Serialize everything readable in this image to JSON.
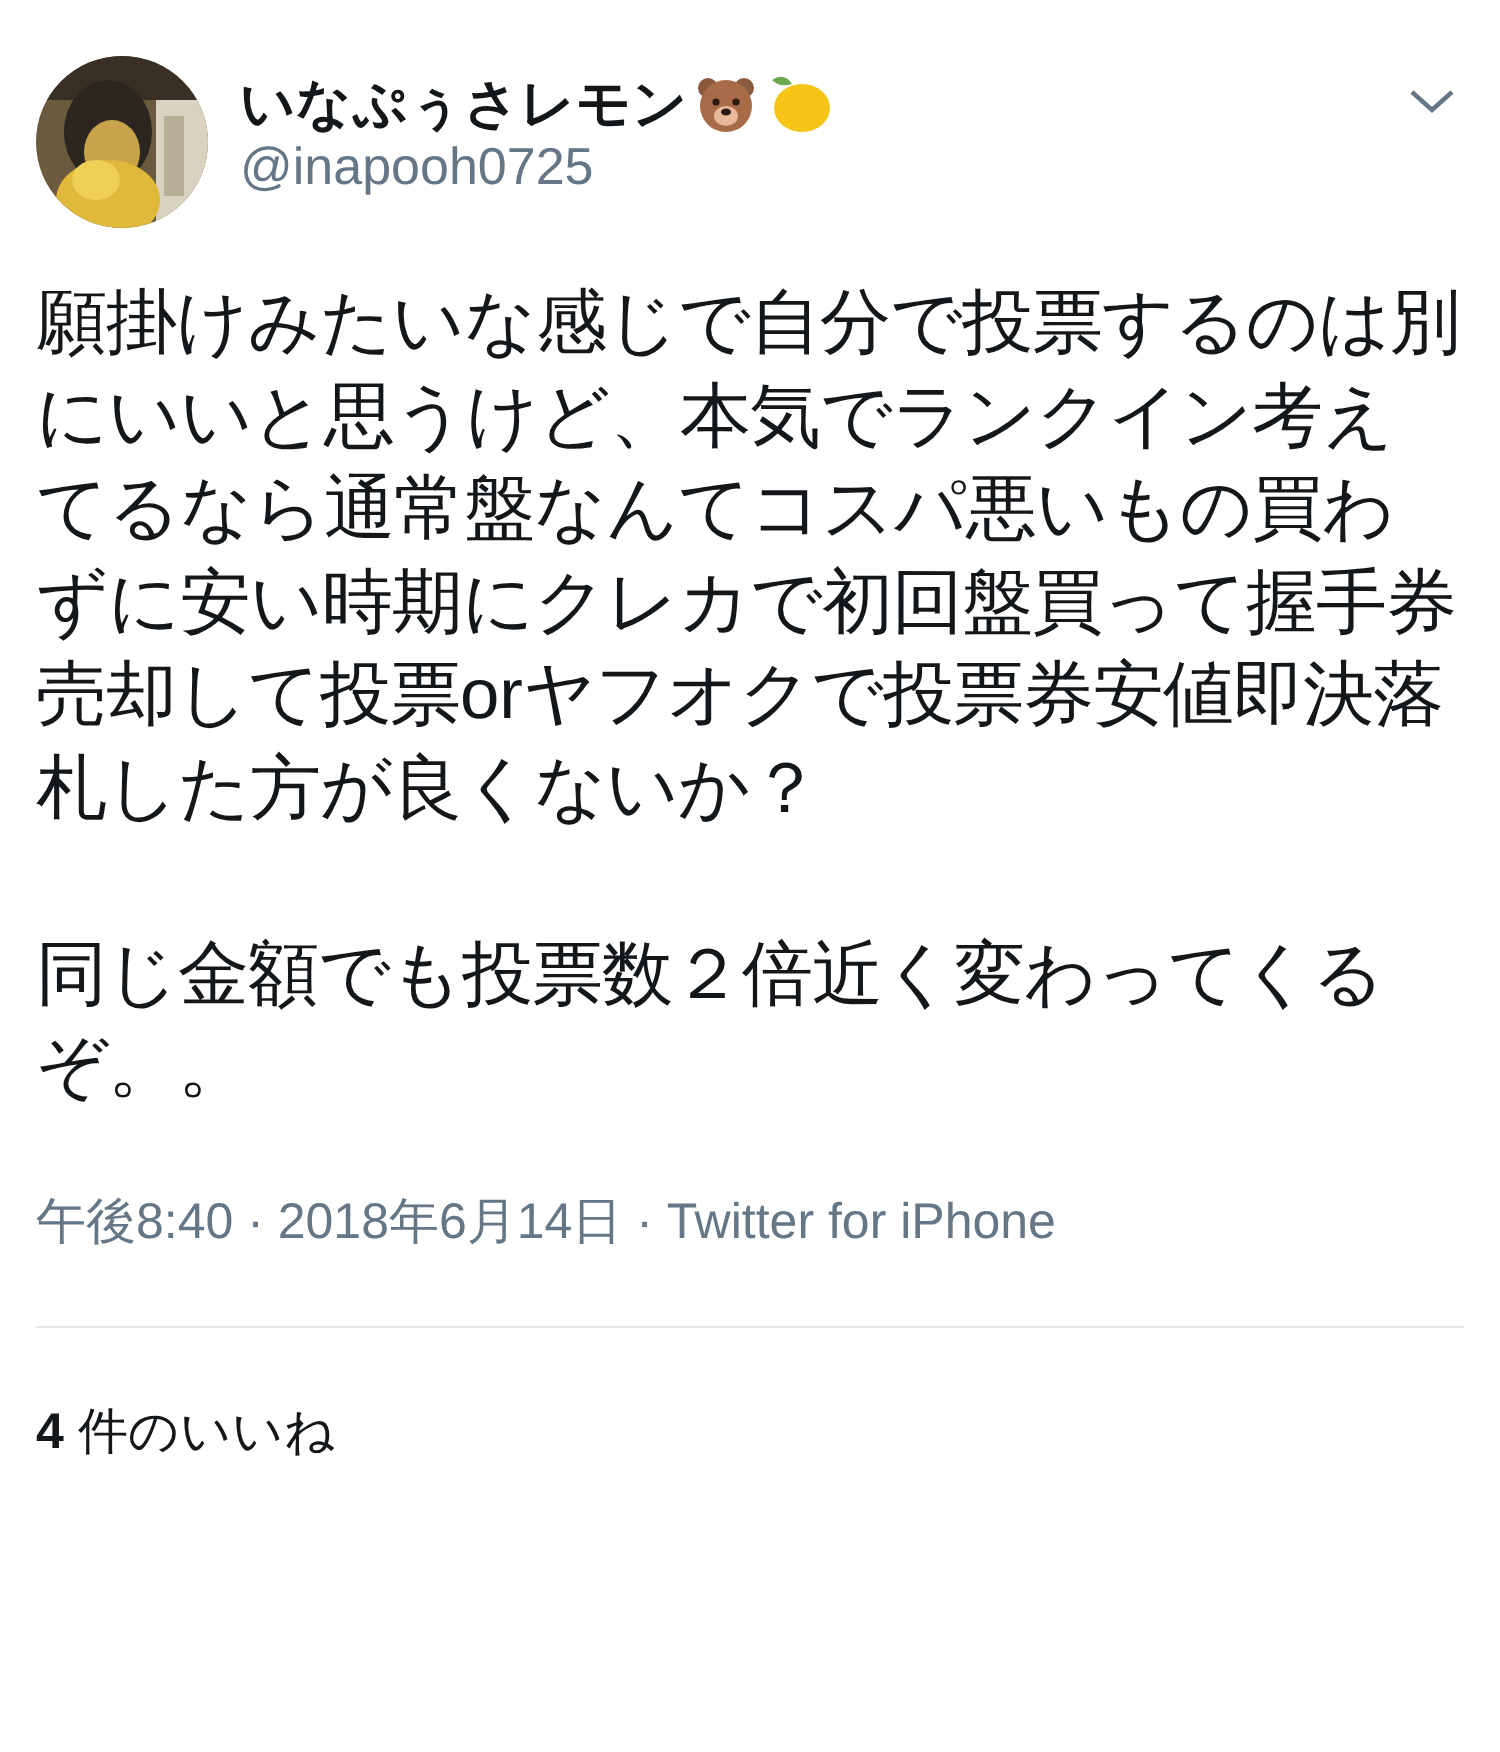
{
  "author": {
    "display_name": "いなぷぅさレモン",
    "handle": "@inapooh0725"
  },
  "tweet": {
    "paragraphs": [
      "願掛けみたいな感じで自分で投票するのは別にいいと思うけど、本気でランクイン考えてるなら通常盤なんてコスパ悪いもの買わずに安い時期にクレカで初回盤買って握手券売却して投票orヤフオクで投票券安値即決落札した方が良くないか？",
      "同じ金額でも投票数２倍近く変わってくるぞ。。"
    ]
  },
  "meta": "午後8:40 · 2018年6月14日 · Twitter for iPhone",
  "likes": "**4** 件のいいね"
}
